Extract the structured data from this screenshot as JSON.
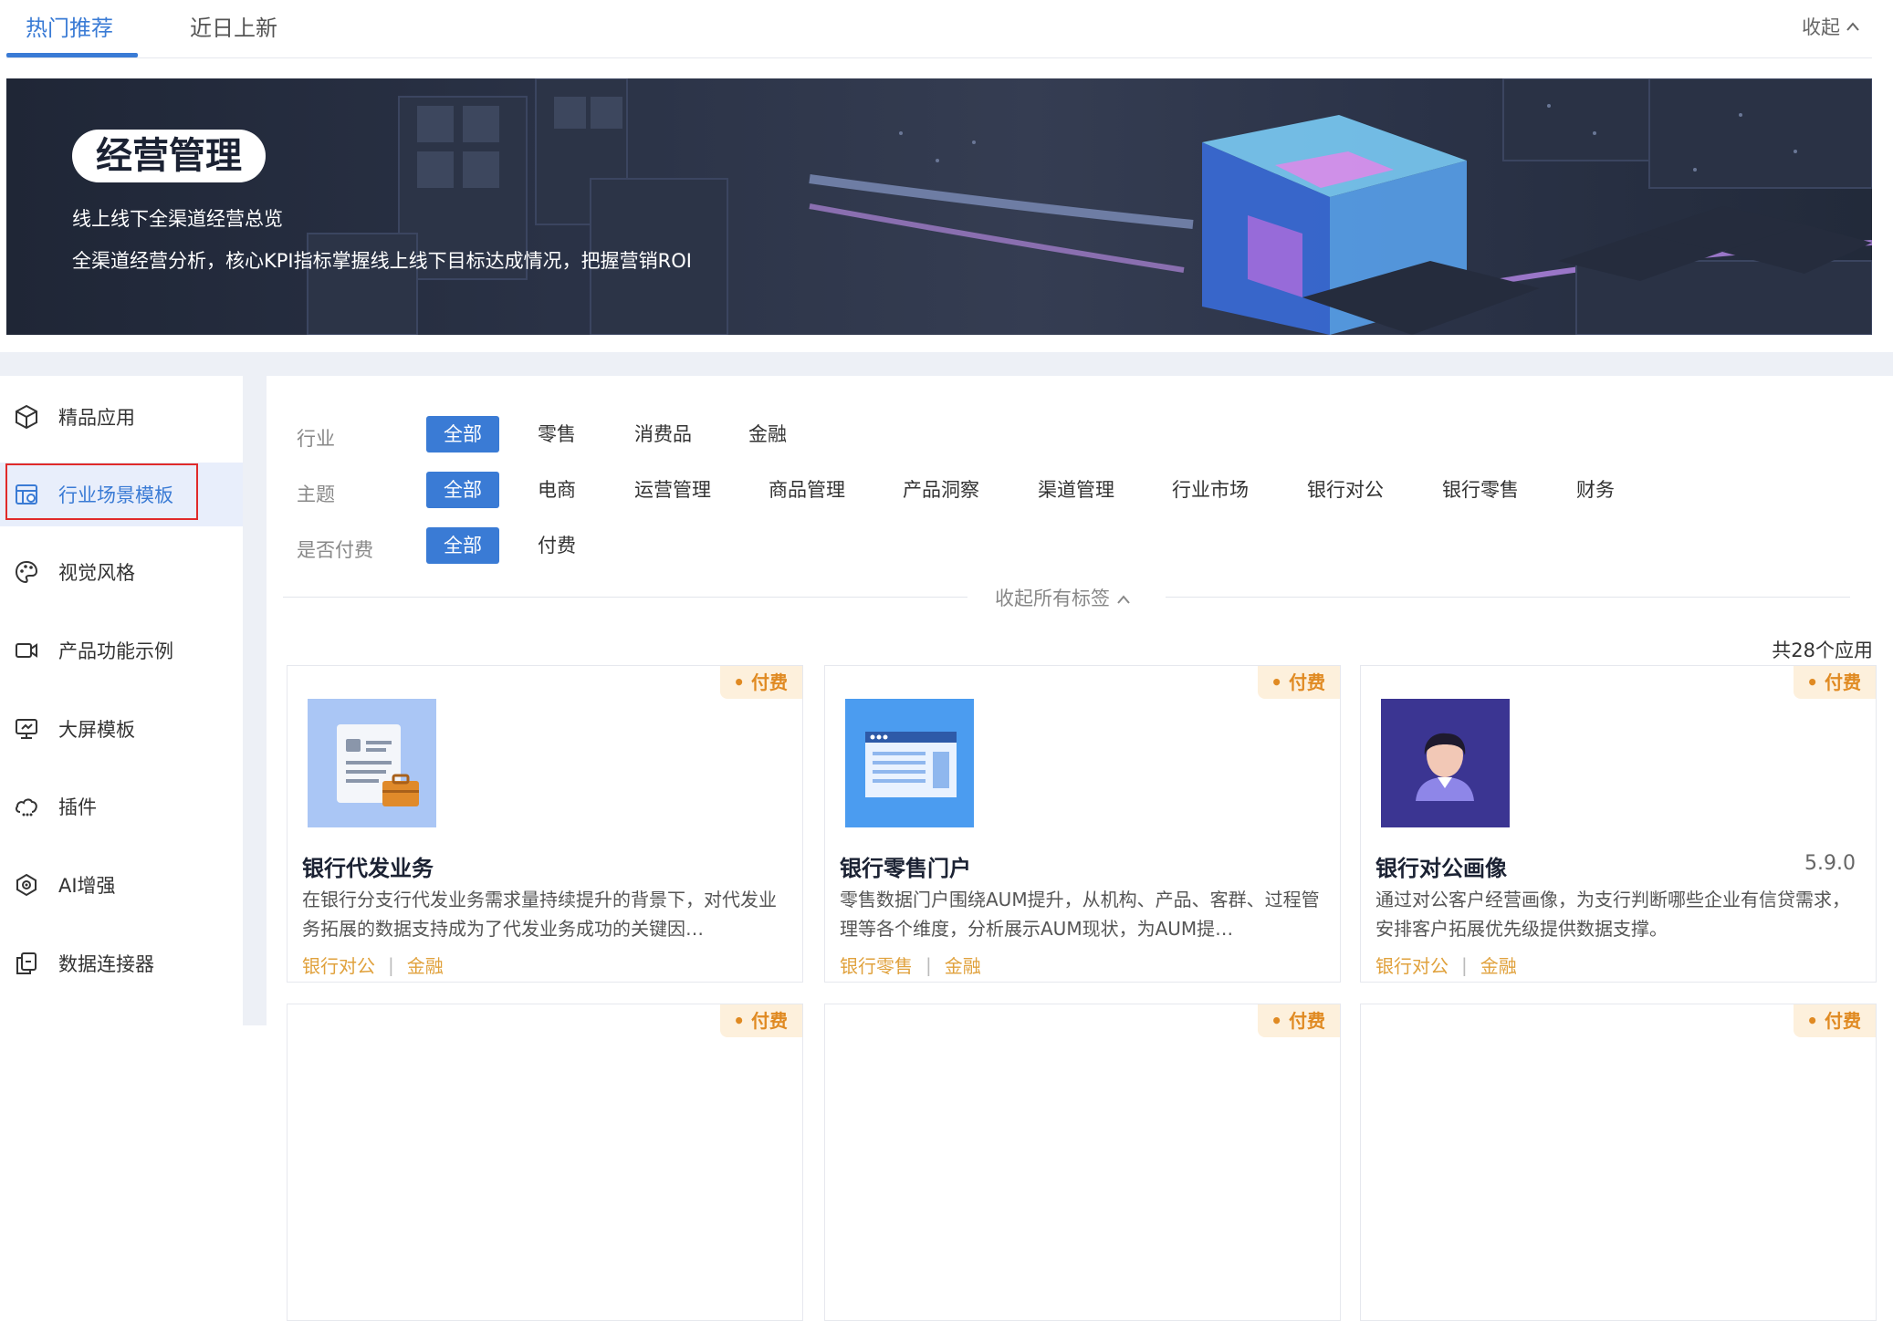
{
  "tabs": [
    {
      "label": "热门推荐"
    },
    {
      "label": "近日上新"
    }
  ],
  "collapse_label": "收起",
  "banner": {
    "title": "经营管理",
    "subtitle1": "线上线下全渠道经营总览",
    "subtitle2": "全渠道经营分析，核心KPI指标掌握线上线下目标达成情况，把握营销ROI"
  },
  "sidebar": {
    "items": [
      {
        "label": "精品应用",
        "icon": "cube-icon"
      },
      {
        "label": "行业场景模板",
        "icon": "template-icon"
      },
      {
        "label": "视觉风格",
        "icon": "palette-icon"
      },
      {
        "label": "产品功能示例",
        "icon": "video-icon"
      },
      {
        "label": "大屏模板",
        "icon": "monitor-icon"
      },
      {
        "label": "插件",
        "icon": "cloud-plugin-icon"
      },
      {
        "label": "AI增强",
        "icon": "eye-icon"
      },
      {
        "label": "数据连接器",
        "icon": "connector-icon"
      }
    ],
    "active_index": 1
  },
  "filters": {
    "industry": {
      "label": "行业",
      "options": [
        "全部",
        "零售",
        "消费品",
        "金融"
      ]
    },
    "theme": {
      "label": "主题",
      "options": [
        "全部",
        "电商",
        "运营管理",
        "商品管理",
        "产品洞察",
        "渠道管理",
        "行业市场",
        "银行对公",
        "银行零售",
        "财务"
      ]
    },
    "paid": {
      "label": "是否付费",
      "options": [
        "全部",
        "付费"
      ]
    },
    "collapse_all": "收起所有标签"
  },
  "total_label": "共28个应用",
  "cards": [
    {
      "badge": "付费",
      "title": "银行代发业务",
      "version": "",
      "desc": "在银行分支行代发业务需求量持续提升的背景下，对代发业务拓展的数据支持成为了代发业务成功的关键因…",
      "tags": [
        "银行对公",
        "金融"
      ],
      "thumb_bg": "#aac6f5",
      "thumb": "document-briefcase-icon"
    },
    {
      "badge": "付费",
      "title": "银行零售门户",
      "version": "",
      "desc": "零售数据门户围绕AUM提升，从机构、产品、客群、过程管理等各个维度，分析展示AUM现状，为AUM提…",
      "tags": [
        "银行零售",
        "金融"
      ],
      "thumb_bg": "#4b9cf0",
      "thumb": "browser-window-icon"
    },
    {
      "badge": "付费",
      "title": "银行对公画像",
      "version": "5.9.0",
      "desc": "通过对公客户经营画像，为支行判断哪些企业有信贷需求，安排客户拓展优先级提供数据支撑。",
      "tags": [
        "银行对公",
        "金融"
      ],
      "thumb_bg": "#3b3592",
      "thumb": "person-avatar-icon"
    }
  ],
  "second_row_badges": [
    "付费",
    "付费",
    "付费"
  ],
  "colors": {
    "accent": "#3a7bd5",
    "badge_text": "#e08a22",
    "badge_bg": "#fdf0dc",
    "tag": "#e0a13c",
    "highlight_box": "#e02a2a"
  }
}
